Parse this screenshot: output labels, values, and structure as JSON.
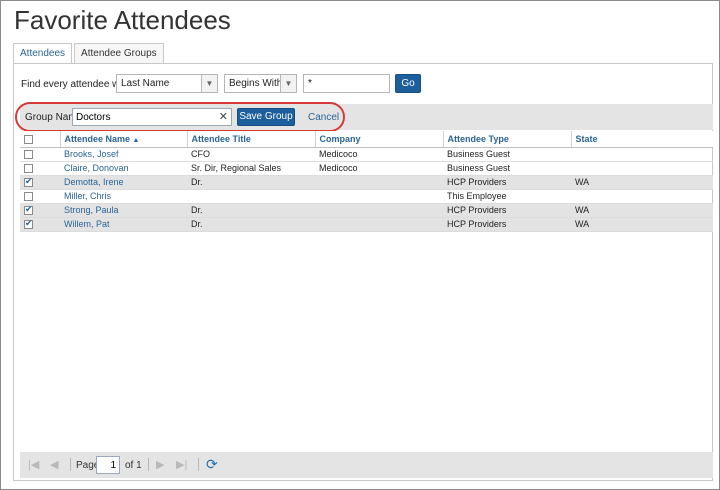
{
  "page": {
    "title": "Favorite Attendees"
  },
  "tabs": [
    {
      "label": "Attendees",
      "active": false
    },
    {
      "label": "Attendee Groups",
      "active": true
    }
  ],
  "filter": {
    "label": "Find every attendee where",
    "field_value": "Last Name",
    "operator_value": "Begins With",
    "search_value": "*",
    "go_label": "Go"
  },
  "group": {
    "label": "Group Name",
    "name_value": "Doctors",
    "save_label": "Save Group",
    "cancel_label": "Cancel"
  },
  "table": {
    "columns": [
      "Attendee Name",
      "Attendee Title",
      "Company",
      "Attendee Type",
      "State"
    ],
    "sort_indicator": "▲",
    "rows": [
      {
        "checked": false,
        "name": "Brooks, Josef",
        "title": "CFO",
        "company": "Medicoco",
        "type": "Business Guest",
        "state": ""
      },
      {
        "checked": false,
        "name": "Claire, Donovan",
        "title": "Sr. Dir, Regional Sales",
        "company": "Medicoco",
        "type": "Business Guest",
        "state": ""
      },
      {
        "checked": true,
        "name": "Demotta, Irene",
        "title": "Dr.",
        "company": "",
        "type": "HCP Providers",
        "state": "WA"
      },
      {
        "checked": false,
        "name": "Miller, Chris",
        "title": "",
        "company": "",
        "type": "This Employee",
        "state": ""
      },
      {
        "checked": true,
        "name": "Strong, Paula",
        "title": "Dr.",
        "company": "",
        "type": "HCP Providers",
        "state": "WA"
      },
      {
        "checked": true,
        "name": "Willem, Pat",
        "title": "Dr.",
        "company": "",
        "type": "HCP Providers",
        "state": "WA"
      }
    ]
  },
  "pager": {
    "page_label": "Page",
    "page_value": "1",
    "of_label": "of 1"
  },
  "colors": {
    "accent": "#1c5f9c",
    "link": "#2a6496",
    "highlight": "#d83a3a",
    "selected_row": "#e3e3e3"
  }
}
